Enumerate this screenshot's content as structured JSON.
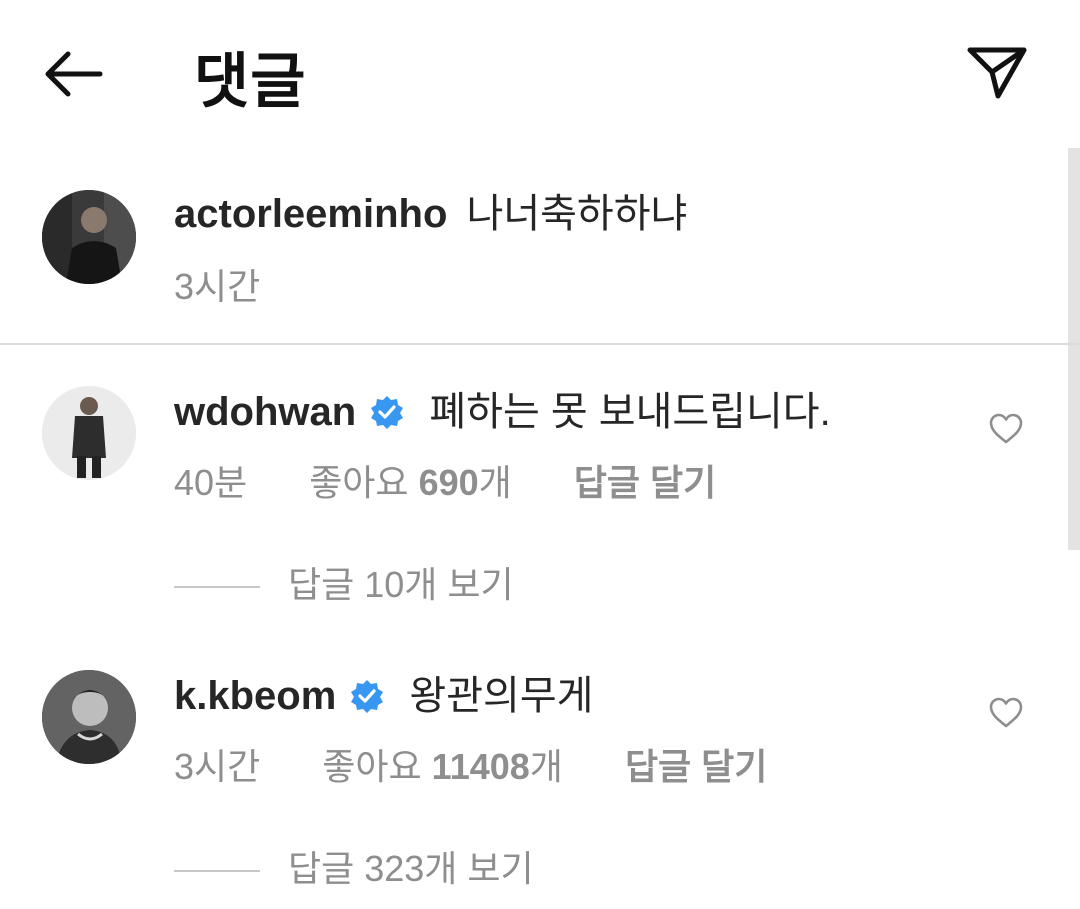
{
  "header": {
    "title": "댓글",
    "back_icon": "arrow-left-icon",
    "send_icon": "paper-plane-icon"
  },
  "caption": {
    "username": "actorleeminho",
    "text": "나너축하하냐",
    "time": "3시간"
  },
  "comments": [
    {
      "username": "wdohwan",
      "verified": true,
      "text": "폐하는 못 보내드립니다.",
      "time": "40분",
      "likes_prefix": "좋아요",
      "likes_count": "690",
      "likes_suffix": "개",
      "reply_label": "답글 달기",
      "view_replies": "답글 10개 보기"
    },
    {
      "username": "k.kbeom",
      "verified": true,
      "text": "왕관의무게",
      "time": "3시간",
      "likes_prefix": "좋아요",
      "likes_count": "11408",
      "likes_suffix": "개",
      "reply_label": "답글 달기",
      "view_replies": "답글 323개 보기"
    }
  ],
  "colors": {
    "text_primary": "#262626",
    "text_secondary": "#8e8e8e",
    "verified_blue": "#3897f0",
    "divider": "#dcdcdc"
  }
}
